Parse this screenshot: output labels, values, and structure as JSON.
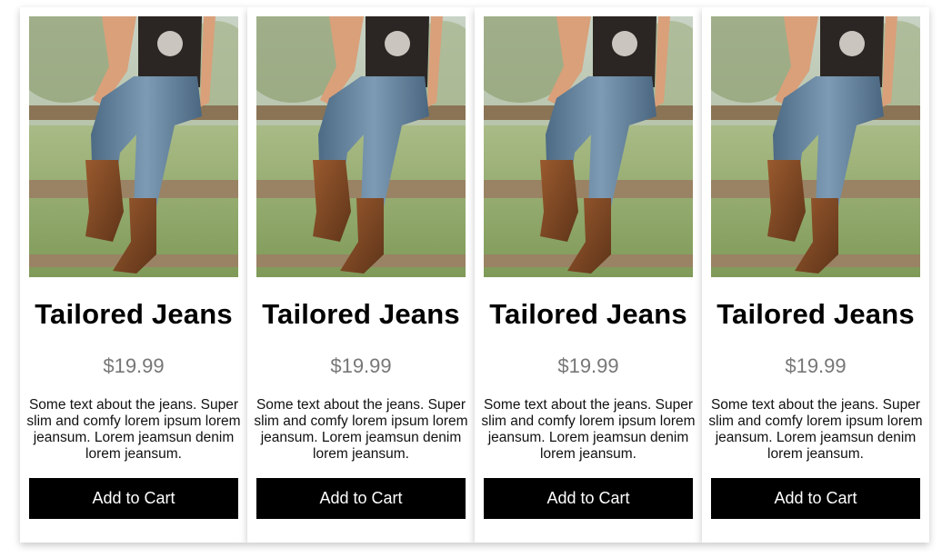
{
  "products": [
    {
      "image_alt": "person in jeans and cowboy boots sitting on a wooden fence",
      "title": "Tailored Jeans",
      "price": "$19.99",
      "description": "Some text about the jeans. Super slim and comfy lorem ipsum lorem jeansum. Lorem jeamsun denim lorem jeansum.",
      "button_label": "Add to Cart"
    },
    {
      "image_alt": "person in jeans and cowboy boots sitting on a wooden fence",
      "title": "Tailored Jeans",
      "price": "$19.99",
      "description": "Some text about the jeans. Super slim and comfy lorem ipsum lorem jeansum. Lorem jeamsun denim lorem jeansum.",
      "button_label": "Add to Cart"
    },
    {
      "image_alt": "person in jeans and cowboy boots sitting on a wooden fence",
      "title": "Tailored Jeans",
      "price": "$19.99",
      "description": "Some text about the jeans. Super slim and comfy lorem ipsum lorem jeansum. Lorem jeamsun denim lorem jeansum.",
      "button_label": "Add to Cart"
    },
    {
      "image_alt": "person in jeans and cowboy boots sitting on a wooden fence",
      "title": "Tailored Jeans",
      "price": "$19.99",
      "description": "Some text about the jeans. Super slim and comfy lorem ipsum lorem jeansum. Lorem jeamsun denim lorem jeansum.",
      "button_label": "Add to Cart"
    }
  ],
  "colors": {
    "button_bg": "#000000",
    "button_text": "#ffffff",
    "price_text": "#777777",
    "card_bg": "#ffffff"
  }
}
